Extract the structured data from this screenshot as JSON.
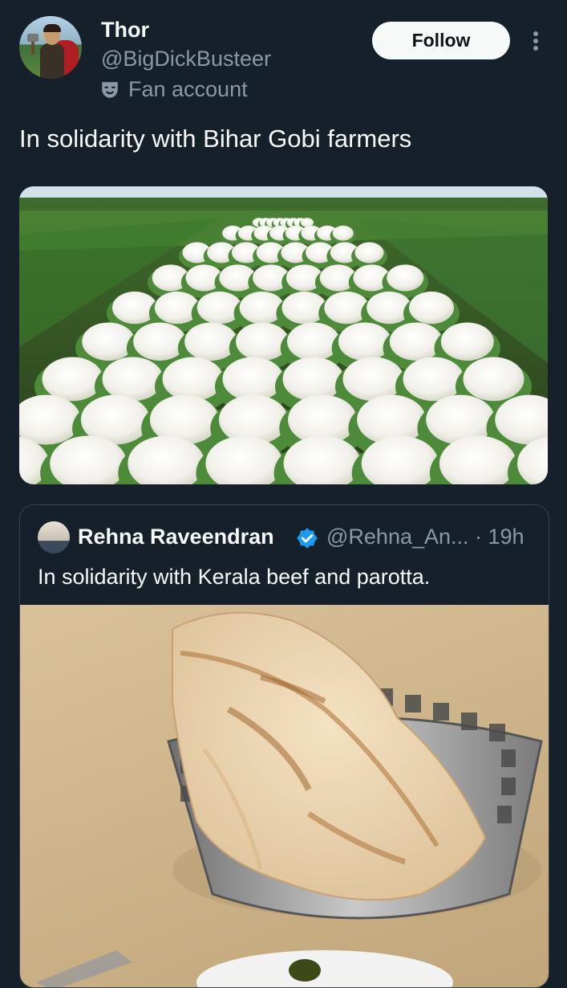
{
  "author": {
    "name": "Thor",
    "handle": "@BigDickBusteer",
    "badge": "Fan account",
    "avatar_icon": "profile-avatar"
  },
  "actions": {
    "follow_label": "Follow",
    "more_icon": "more-vertical-icon"
  },
  "tweet": {
    "text": "In solidarity with Bihar Gobi farmers",
    "media_icon": "cauliflower-field-image"
  },
  "quoted": {
    "name": "Rehna Raveendran",
    "handle_time": "@Rehna_An... · 19h",
    "text": "In solidarity with Kerala beef and parotta.",
    "media_icon": "parotta-basket-image",
    "verified_color": "#1d9bf0"
  },
  "colors": {
    "background": "#15202b",
    "text": "#f7f9f9",
    "muted": "#8b98a5",
    "border": "#38444d"
  }
}
